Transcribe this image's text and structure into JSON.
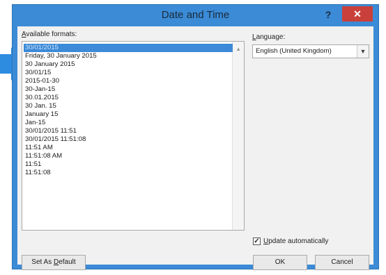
{
  "window": {
    "title": "Date and Time",
    "help_label": "?",
    "close_label": "✕"
  },
  "formats": {
    "label_prefix": "",
    "label_accel": "A",
    "label_rest": "vailable formats:",
    "items": [
      "30/01/2015",
      "Friday, 30 January 2015",
      "30 January 2015",
      "30/01/15",
      "2015-01-30",
      "30-Jan-15",
      "30.01.2015",
      "30 Jan. 15",
      "January 15",
      "Jan-15",
      "30/01/2015 11:51",
      "30/01/2015 11:51:08",
      "11:51 AM",
      "11:51:08 AM",
      "11:51",
      "11:51:08"
    ],
    "selected_index": 0
  },
  "language": {
    "label_accel": "L",
    "label_rest": "anguage:",
    "value": "English (United Kingdom)"
  },
  "update": {
    "checked": true,
    "label_accel": "U",
    "label_rest": "pdate automatically"
  },
  "buttons": {
    "default_pre": "Set As ",
    "default_accel": "D",
    "default_post": "efault",
    "ok": "OK",
    "cancel": "Cancel"
  },
  "colors": {
    "frame": "#3b8bd6",
    "close": "#c9403a",
    "selection": "#3c8ad8",
    "pointer": "#2d8be0"
  },
  "icons": {
    "pointer": "pointer-arrow-icon",
    "dropdown": "chevron-down-icon",
    "scroll_up": "scroll-up-icon",
    "check": "checkmark-icon"
  }
}
